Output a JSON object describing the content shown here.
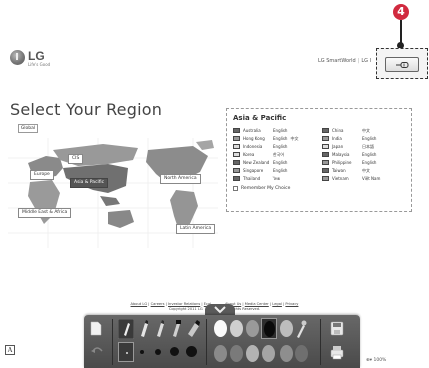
{
  "header": {
    "logo_name": "LG",
    "logo_tagline": "Life's Good",
    "top_links": [
      "LG SmartWorld",
      "LG I"
    ]
  },
  "page_title": "Select Your Region",
  "global_button": "Global",
  "map": {
    "regions": [
      {
        "label": "CIS",
        "active": false
      },
      {
        "label": "Europe",
        "active": false
      },
      {
        "label": "Asia & Pacific",
        "active": true
      },
      {
        "label": "North America",
        "active": false
      },
      {
        "label": "Middle East & Africa",
        "active": false
      },
      {
        "label": "Latin America",
        "active": false
      }
    ]
  },
  "asia_pacific": {
    "title": "Asia & Pacific",
    "countries_left": [
      {
        "name": "Australia",
        "lang": "English",
        "lang2": ""
      },
      {
        "name": "Hong Kong",
        "lang": "English",
        "lang2": "中文"
      },
      {
        "name": "Indonesia",
        "lang": "English",
        "lang2": ""
      },
      {
        "name": "Korea",
        "lang": "한국어",
        "lang2": ""
      },
      {
        "name": "New Zealand",
        "lang": "English",
        "lang2": ""
      },
      {
        "name": "Singapore",
        "lang": "English",
        "lang2": ""
      },
      {
        "name": "Thailand",
        "lang": "ไทย",
        "lang2": ""
      }
    ],
    "countries_right": [
      {
        "name": "China",
        "lang": "中文",
        "lang2": ""
      },
      {
        "name": "India",
        "lang": "English",
        "lang2": ""
      },
      {
        "name": "Japan",
        "lang": "日本語",
        "lang2": ""
      },
      {
        "name": "Malaysia",
        "lang": "English",
        "lang2": ""
      },
      {
        "name": "Philippine",
        "lang": "English",
        "lang2": ""
      },
      {
        "name": "Taiwan",
        "lang": "中文",
        "lang2": ""
      },
      {
        "name": "Vietnam",
        "lang": "Việt Nam",
        "lang2": ""
      }
    ],
    "remember_label": "Remember My Choice"
  },
  "footer": {
    "line1": [
      "About LG",
      "Careers",
      "Investor Relations",
      "Ecol",
      "About Us",
      "Media Center",
      "Legal",
      "Privacy"
    ],
    "line2": "Copyright 2011 LG                          ights Reserved."
  },
  "callout": {
    "number": "4"
  },
  "corner_label": "A",
  "status": {
    "zoom": "100%"
  },
  "colors": {
    "callout_red": "#d12a3f",
    "toolbar_bg": "#555555"
  },
  "toolbar": {
    "icons": [
      "page-icon",
      "pen-icon",
      "marker-icon",
      "highlighter-icon",
      "eraser-icon",
      "color-swatch-icon",
      "save-icon",
      "undo-icon"
    ]
  }
}
